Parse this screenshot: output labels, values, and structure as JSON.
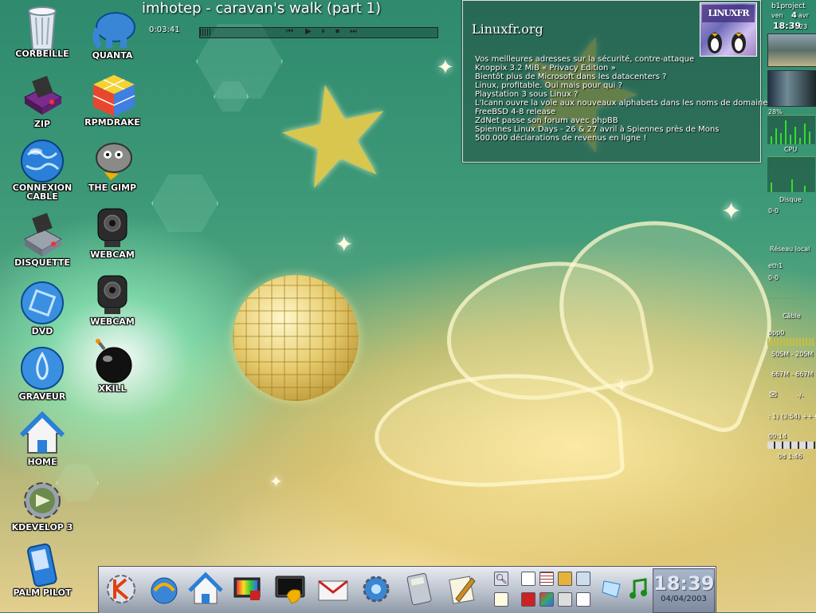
{
  "desktop": {
    "icons": [
      {
        "label": "CORBEILLE"
      },
      {
        "label": "ZIP"
      },
      {
        "label": "CONNEXION CABLE"
      },
      {
        "label": "DISQUETTE"
      },
      {
        "label": "DVD"
      },
      {
        "label": "GRAVEUR"
      },
      {
        "label": "HOME"
      },
      {
        "label": "KDEVELOP 3"
      },
      {
        "label": "PALM PILOT"
      },
      {
        "label": "QUANTA"
      },
      {
        "label": "RPMDRAKE"
      },
      {
        "label": "THE GIMP"
      },
      {
        "label": "WEBCAM"
      },
      {
        "label": "WEBCAM"
      },
      {
        "label": "XKILL"
      }
    ]
  },
  "player": {
    "title": "imhotep - caravan's walk (part 1)",
    "elapsed": "0:03:41",
    "controls": [
      "⏮",
      "▶",
      "⏸",
      "⏹",
      "⏭"
    ]
  },
  "news": {
    "site": "Linuxfr.org",
    "logo_text": "LINUXFR",
    "items": [
      "Vos meilleures adresses sur la sécurité, contre-attaque",
      "Knoppix 3.2 MiB « Privacy Edition »",
      "Bientôt plus de Microsoft dans les datacenters ?",
      "Linux, profitable. Oui mais pour qui ?",
      "Playstation 3 sous Linux ?",
      "L'Icann ouvre la voie aux nouveaux alphabets dans les noms de domaine",
      "FreeBSD 4-8 release",
      "ZdNet passe son forum avec phpBB",
      "Spiennes Linux Days - 26 & 27 avril à Spiennes près de Mons",
      "500.000 déclarations de revenus en ligne !"
    ]
  },
  "sys": {
    "host": "b1project",
    "day": "ven",
    "daynum": "4",
    "month": "avr",
    "time": "18:39",
    "seconds": "23",
    "cpu_pct": "28%",
    "cpu_label": "CPU",
    "disk_label": "Disque",
    "disk_val": "0-0",
    "lan_label": "Réseau local",
    "eth_label": "eth1",
    "eth_val": "0-0",
    "cable_label": "Câble",
    "ppp_label": "ppp0",
    "ppp_rate1": "50SM - 205M",
    "ppp_rate2": "667M - 667M",
    "mail_count": "-/-",
    "track": ": 1) (3:54) +++",
    "track_time": "00:14",
    "track_end": "0d  1:46"
  },
  "taskbar": {
    "clock_time": "18:39",
    "clock_date": "04/04/2003"
  }
}
